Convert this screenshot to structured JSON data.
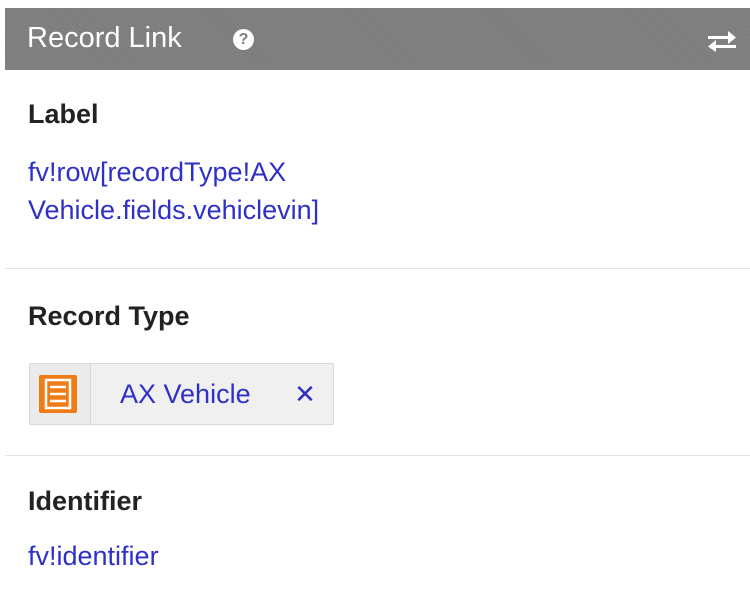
{
  "header": {
    "title": "Record Link",
    "help_icon": "question-circle-icon",
    "help_glyph": "?",
    "swap_icon": "swap-arrows-icon"
  },
  "sections": {
    "label": {
      "heading": "Label",
      "value_line1": "fv!row[recordType!AX",
      "value_line2": "Vehicle.fields.vehiclevin]"
    },
    "record_type": {
      "heading": "Record Type",
      "chip": {
        "icon": "record-type-icon",
        "label": "AX Vehicle",
        "remove_glyph": "✕"
      }
    },
    "identifier": {
      "heading": "Identifier",
      "value": "fv!identifier"
    }
  },
  "colors": {
    "header_bg": "#7d7d7d",
    "link": "#2f30c7",
    "record_icon": "#f07c17",
    "divider": "#e3e3e3"
  }
}
